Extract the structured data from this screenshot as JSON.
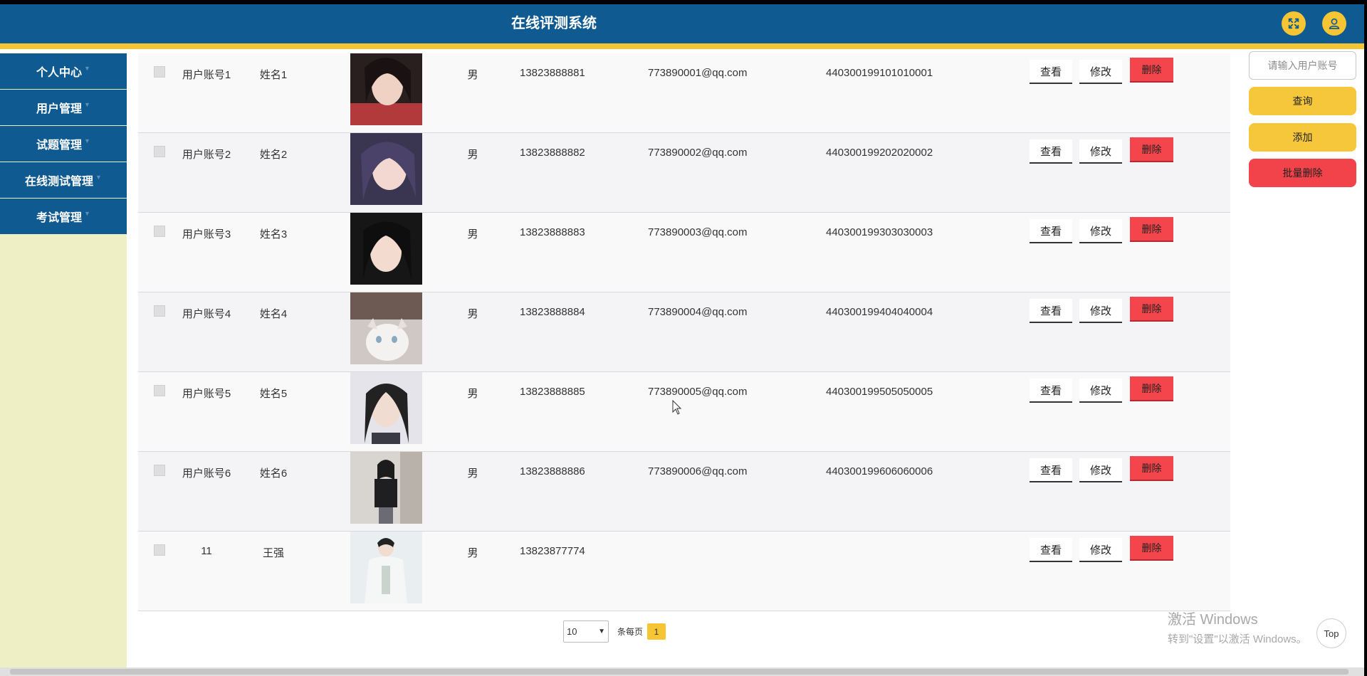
{
  "header": {
    "title": "在线评测系统",
    "fullscreen_icon": "fullscreen-icon",
    "user_icon": "user-icon",
    "colors": {
      "bar": "#0f5a90",
      "stripe": "#f6c534"
    }
  },
  "sidebar": {
    "items": [
      {
        "label": "个人中心"
      },
      {
        "label": "用户管理"
      },
      {
        "label": "试题管理"
      },
      {
        "label": "在线测试管理"
      },
      {
        "label": "考试管理"
      }
    ]
  },
  "table": {
    "rows": [
      {
        "account": "用户账号1",
        "name": "姓名1",
        "sex": "男",
        "phone": "13823888881",
        "email": "773890001@qq.com",
        "id_number": "440300199101010001"
      },
      {
        "account": "用户账号2",
        "name": "姓名2",
        "sex": "男",
        "phone": "13823888882",
        "email": "773890002@qq.com",
        "id_number": "440300199202020002"
      },
      {
        "account": "用户账号3",
        "name": "姓名3",
        "sex": "男",
        "phone": "13823888883",
        "email": "773890003@qq.com",
        "id_number": "440300199303030003"
      },
      {
        "account": "用户账号4",
        "name": "姓名4",
        "sex": "男",
        "phone": "13823888884",
        "email": "773890004@qq.com",
        "id_number": "440300199404040004"
      },
      {
        "account": "用户账号5",
        "name": "姓名5",
        "sex": "男",
        "phone": "13823888885",
        "email": "773890005@qq.com",
        "id_number": "440300199505050005"
      },
      {
        "account": "用户账号6",
        "name": "姓名6",
        "sex": "男",
        "phone": "13823888886",
        "email": "773890006@qq.com",
        "id_number": "440300199606060006"
      },
      {
        "account": "11",
        "name": "王强",
        "sex": "男",
        "phone": "13823877774",
        "email": "",
        "id_number": ""
      }
    ],
    "actions": {
      "view": "查看",
      "edit": "修改",
      "delete": "删除"
    }
  },
  "right_panel": {
    "search_placeholder": "请输入用户账号",
    "query_label": "查询",
    "add_label": "添加",
    "bulk_delete_label": "批量删除"
  },
  "pagination": {
    "page_size": "10",
    "per_page_label": "条每页",
    "current_page": "1"
  },
  "top_button": "Top",
  "watermark": {
    "line1": "激活 Windows",
    "line2": "转到\"设置\"以激活 Windows。"
  }
}
